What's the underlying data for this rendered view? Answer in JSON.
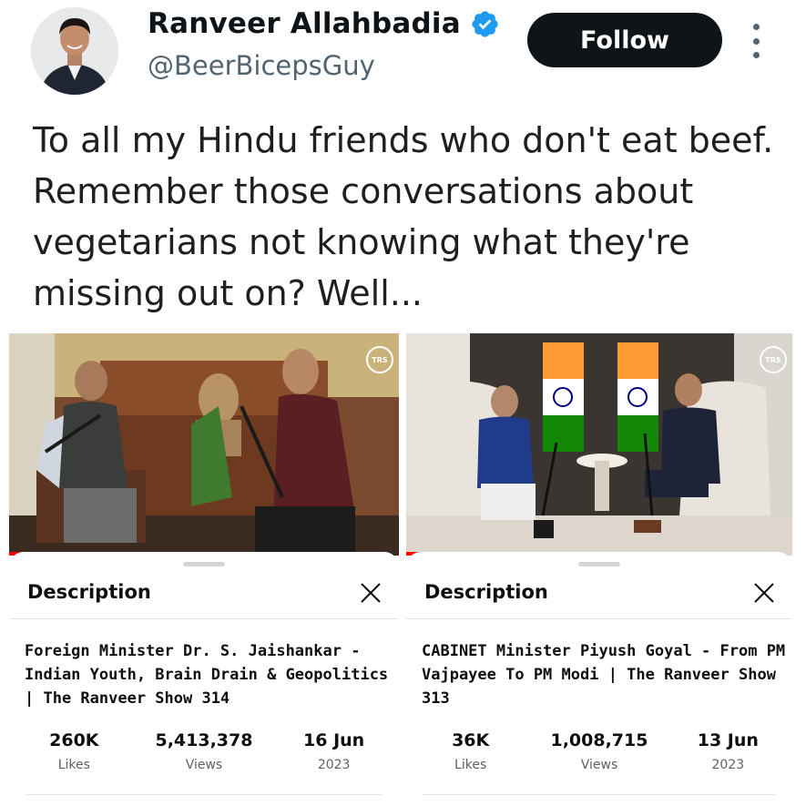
{
  "author": {
    "name": "Ranveer Allahbadia",
    "handle": "@BeerBicepsGuy",
    "verified": true
  },
  "follow_label": "Follow",
  "tweet": {
    "text": "To all my Hindu friends who don't eat beef. Remember those conversations about vegetarians not knowing what they're missing out on? Well..."
  },
  "videos": [
    {
      "watermark": "TRS",
      "sheet_title": "Description",
      "title": "Foreign Minister Dr. S. Jaishankar - Indian Youth, Brain Drain & Geopolitics | The Ranveer Show 314",
      "stats": [
        {
          "value": "260K",
          "label": "Likes"
        },
        {
          "value": "5,413,378",
          "label": "Views"
        },
        {
          "value": "16 Jun",
          "label": "2023"
        }
      ]
    },
    {
      "watermark": "TRS",
      "sheet_title": "Description",
      "title": "CABINET Minister Piyush Goyal - From PM Vajpayee To PM Modi | The Ranveer Show 313",
      "stats": [
        {
          "value": "36K",
          "label": "Likes"
        },
        {
          "value": "1,008,715",
          "label": "Views"
        },
        {
          "value": "13 Jun",
          "label": "2023"
        }
      ]
    }
  ],
  "colors": {
    "follow_bg": "#0f1419",
    "verified": "#1d9bf0",
    "progress": "#ff0000",
    "handle": "#536471"
  }
}
